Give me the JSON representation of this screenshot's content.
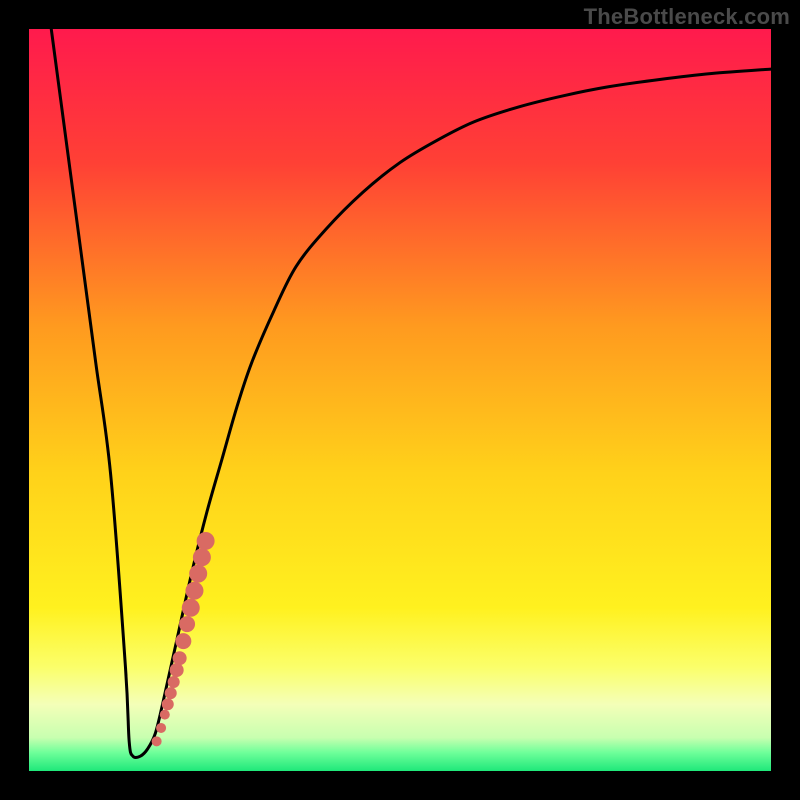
{
  "attribution": "TheBottleneck.com",
  "colors": {
    "frame": "#000000",
    "curve": "#000000",
    "marker": "#d96a63"
  },
  "chart_data": {
    "type": "line",
    "title": "",
    "xlabel": "",
    "ylabel": "",
    "xlim": [
      0,
      100
    ],
    "ylim": [
      0,
      100
    ],
    "grid": false,
    "legend": false,
    "gradient_stops": [
      {
        "pos": 0.0,
        "color": "#ff1a4d"
      },
      {
        "pos": 0.18,
        "color": "#ff4035"
      },
      {
        "pos": 0.4,
        "color": "#ff9a1f"
      },
      {
        "pos": 0.6,
        "color": "#ffd21a"
      },
      {
        "pos": 0.78,
        "color": "#fff11f"
      },
      {
        "pos": 0.86,
        "color": "#fbff6a"
      },
      {
        "pos": 0.91,
        "color": "#f4ffb8"
      },
      {
        "pos": 0.955,
        "color": "#c8ffb0"
      },
      {
        "pos": 0.975,
        "color": "#6fff9a"
      },
      {
        "pos": 1.0,
        "color": "#1fe87a"
      }
    ],
    "series": [
      {
        "name": "bottleneck-curve",
        "x": [
          3,
          5,
          7,
          9,
          11,
          13,
          13.5,
          14,
          15,
          16,
          17,
          18,
          20,
          22,
          24,
          26,
          28,
          30,
          33,
          36,
          40,
          45,
          50,
          55,
          60,
          66,
          72,
          78,
          85,
          92,
          100
        ],
        "y": [
          100,
          85,
          70,
          55,
          40,
          14,
          4,
          2,
          2,
          3,
          5,
          9,
          18,
          27,
          35,
          42,
          49,
          55,
          62,
          68,
          73,
          78,
          82,
          85,
          87.5,
          89.5,
          91,
          92.2,
          93.2,
          94,
          94.6
        ]
      }
    ],
    "markers": {
      "name": "highlight-cluster",
      "x": [
        17.2,
        17.8,
        18.3,
        18.7,
        19.1,
        19.5,
        19.9,
        20.3,
        20.8,
        21.3,
        21.8,
        22.3,
        22.8,
        23.3,
        23.8
      ],
      "y": [
        4.0,
        5.8,
        7.6,
        9.0,
        10.5,
        12.0,
        13.6,
        15.2,
        17.5,
        19.8,
        22.0,
        24.3,
        26.6,
        28.8,
        31.0
      ],
      "r": [
        5,
        5,
        5,
        6,
        6,
        6,
        7,
        7,
        8,
        8,
        9,
        9,
        9,
        9,
        9
      ]
    }
  }
}
